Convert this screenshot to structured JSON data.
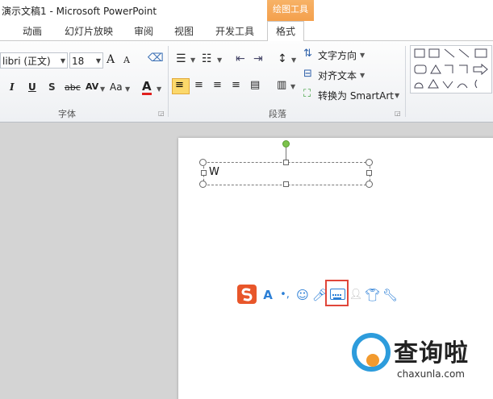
{
  "window": {
    "title": "演示文稿1 - Microsoft PowerPoint"
  },
  "context_tab": {
    "label": "绘图工具"
  },
  "tabs": [
    {
      "label": "动画"
    },
    {
      "label": "幻灯片放映"
    },
    {
      "label": "审阅"
    },
    {
      "label": "视图"
    },
    {
      "label": "开发工具"
    },
    {
      "label": "格式"
    }
  ],
  "font_group": {
    "font_name": "libri (正文)",
    "font_size": "18",
    "grow": "A",
    "shrink": "A",
    "italic": "I",
    "underline": "U",
    "shadow": "S",
    "strike": "abc",
    "spacing": "AV",
    "case": "Aa",
    "color": "A",
    "label": "字体"
  },
  "paragraph_group": {
    "text_direction": "文字方向",
    "align_text": "对齐文本",
    "convert_smartart": "转换为 SmartArt",
    "label": "段落"
  },
  "slide": {
    "textbox_text": "W"
  },
  "watermark": {
    "text": "查询啦",
    "url": "chaxunla.com"
  },
  "colors": {
    "accent": "#f4a04c",
    "highlight": "#e0463a",
    "ime_blue": "#2c7fd6"
  }
}
